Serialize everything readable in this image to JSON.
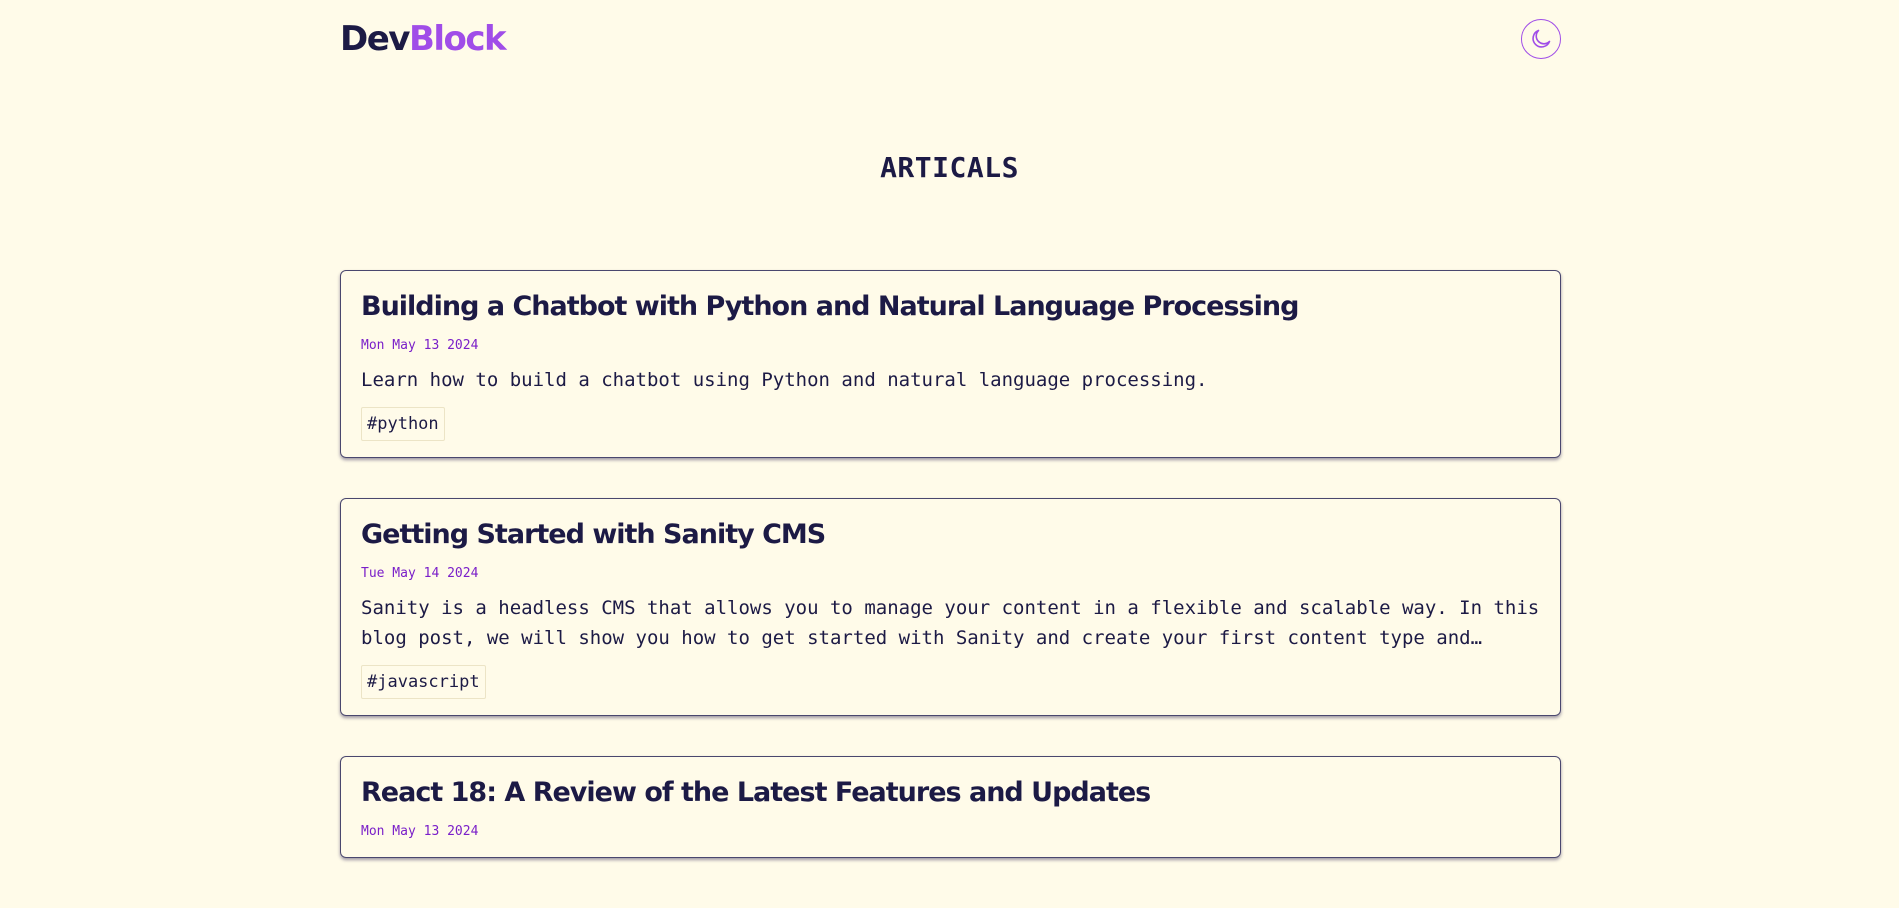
{
  "header": {
    "logo_part1": "Dev",
    "logo_part2": "Block",
    "theme_toggle_icon": "moon-icon",
    "accent_color": "#a04de8"
  },
  "page": {
    "title": "ARTICALS"
  },
  "articles": [
    {
      "title": "Building a Chatbot with Python and Natural Language Processing",
      "date": "Mon May 13 2024",
      "description": "Learn how to build a chatbot using Python and natural language processing.",
      "tags": [
        "#python"
      ]
    },
    {
      "title": "Getting Started with Sanity CMS",
      "date": "Tue May 14 2024",
      "description": "Sanity is a headless CMS that allows you to manage your content in a flexible and scalable way. In this blog post, we will show you how to get started with Sanity and create your first content type and document.",
      "tags": [
        "#javascript"
      ]
    },
    {
      "title": "React 18: A Review of the Latest Features and Updates",
      "date": "Mon May 13 2024",
      "description": "",
      "tags": []
    }
  ]
}
